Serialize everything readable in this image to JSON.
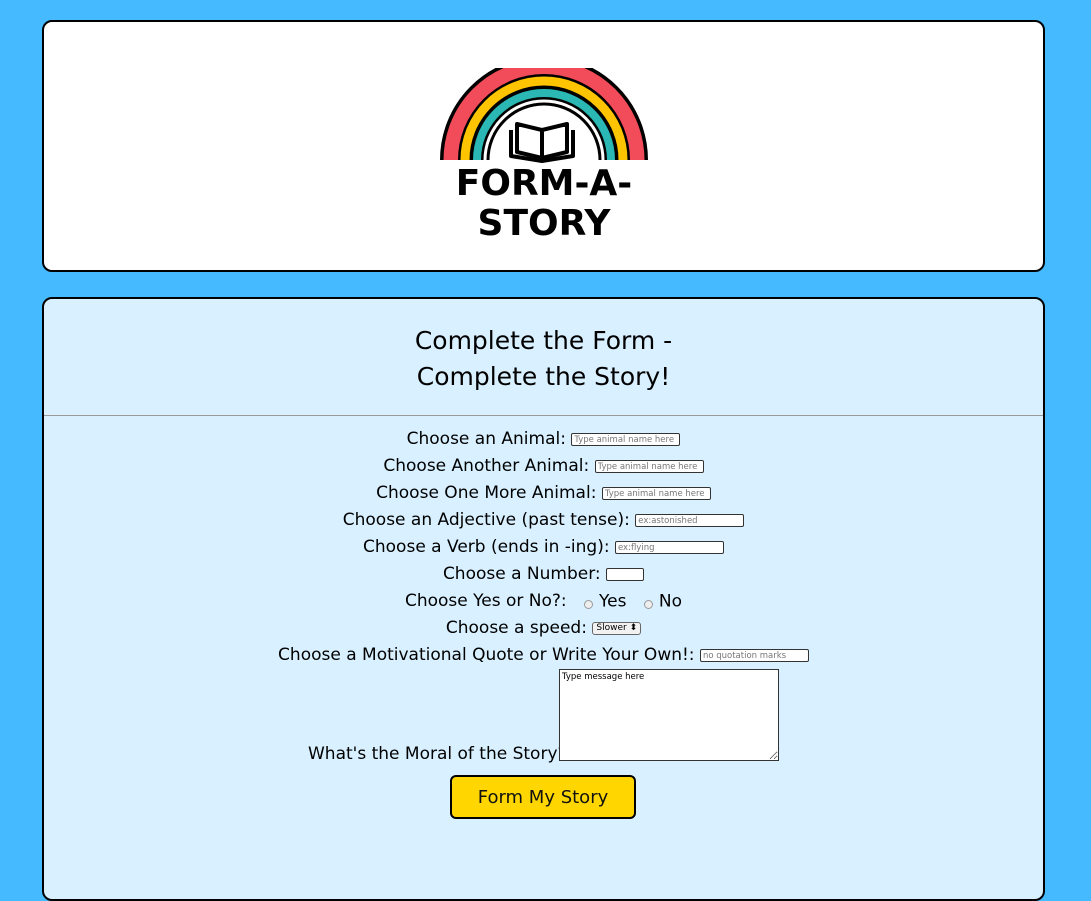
{
  "header": {
    "logo_text": "FORM-A-STORY"
  },
  "form": {
    "title_line1": "Complete the Form -",
    "title_line2": "Complete the Story!",
    "fields": [
      {
        "label": "Choose an Animal:",
        "placeholder": "Type animal name here"
      },
      {
        "label": "Choose Another Animal:",
        "placeholder": "Type animal name here"
      },
      {
        "label": "Choose One More Animal:",
        "placeholder": "Type animal name here"
      },
      {
        "label": "Choose an Adjective (past tense):",
        "placeholder": "ex:astonished"
      },
      {
        "label": "Choose a Verb (ends in -ing):",
        "placeholder": "ex:flying"
      },
      {
        "label": "Choose a Number:",
        "placeholder": ""
      }
    ],
    "yes_no": {
      "label": "Choose Yes or No?:",
      "yes": "Yes",
      "no": "No"
    },
    "speed": {
      "label": "Choose a speed:",
      "selected": "Slower"
    },
    "quote": {
      "label": "Choose a Motivational Quote or Write Your Own!:",
      "placeholder": "no quotation marks"
    },
    "moral": {
      "label": "What's the Moral of the Story?:",
      "placeholder": "Type message here"
    },
    "submit_label": "Form My Story"
  },
  "colors": {
    "background": "#45baff",
    "form_background": "#d8f0ff",
    "button": "#ffd600",
    "rainbow": [
      "#f24b59",
      "#ffc400",
      "#2bb7b3"
    ]
  }
}
